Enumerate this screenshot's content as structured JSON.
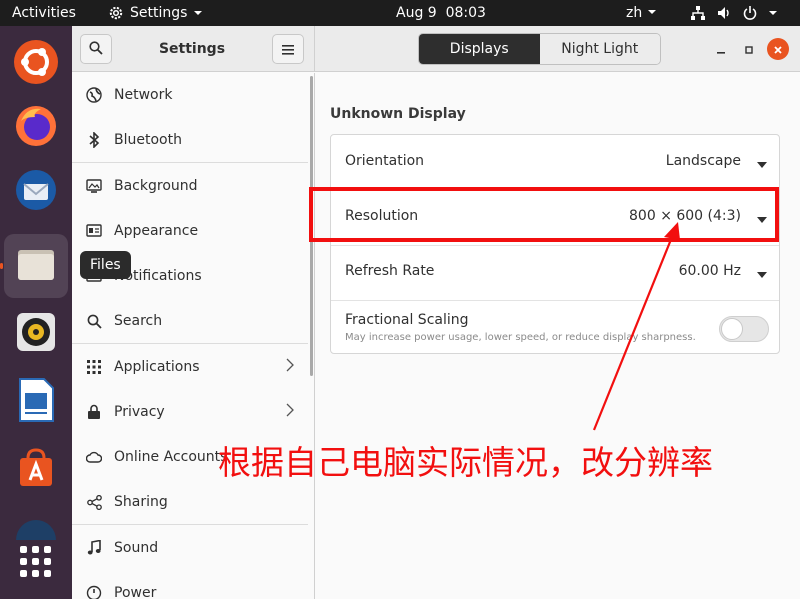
{
  "topbar": {
    "activities": "Activities",
    "app_menu": "Settings",
    "date": "Aug 9",
    "time": "08:03",
    "input_method": "zh"
  },
  "dock": {
    "tooltip": "Files",
    "items": [
      {
        "icon": "ubuntu-software-logo-icon"
      },
      {
        "icon": "firefox-icon"
      },
      {
        "icon": "thunderbird-icon"
      },
      {
        "icon": "files-icon",
        "active": true
      },
      {
        "icon": "rhythmbox-icon"
      },
      {
        "icon": "libreoffice-writer-icon"
      },
      {
        "icon": "ubuntu-software-icon"
      },
      {
        "icon": "help-icon"
      },
      {
        "icon": "show-apps-icon"
      }
    ]
  },
  "header": {
    "title": "Settings",
    "tabs": [
      {
        "label": "Displays",
        "active": true
      },
      {
        "label": "Night Light",
        "active": false
      }
    ]
  },
  "sidebar": {
    "items": [
      {
        "label": "Network",
        "icon": "network-icon"
      },
      {
        "label": "Bluetooth",
        "icon": "bluetooth-icon"
      },
      {
        "label": "Background",
        "icon": "background-icon"
      },
      {
        "label": "Appearance",
        "icon": "appearance-icon"
      },
      {
        "label": "Notifications",
        "icon": "notifications-icon"
      },
      {
        "label": "Search",
        "icon": "search-icon"
      },
      {
        "label": "Applications",
        "icon": "applications-icon",
        "chevron": true
      },
      {
        "label": "Privacy",
        "icon": "privacy-icon",
        "chevron": true
      },
      {
        "label": "Online Accounts",
        "icon": "online-accounts-icon"
      },
      {
        "label": "Sharing",
        "icon": "sharing-icon"
      },
      {
        "label": "Sound",
        "icon": "sound-icon"
      },
      {
        "label": "Power",
        "icon": "power-icon"
      }
    ]
  },
  "display": {
    "name": "Unknown Display",
    "orientation": {
      "label": "Orientation",
      "value": "Landscape"
    },
    "resolution": {
      "label": "Resolution",
      "value": "800 × 600 (4:3)"
    },
    "refresh_rate": {
      "label": "Refresh Rate",
      "value": "60.00 Hz"
    },
    "fractional_scaling": {
      "label": "Fractional Scaling",
      "description": "May increase power usage, lower speed, or reduce display sharpness.",
      "enabled": false
    }
  },
  "annotation": {
    "text": "根据自己电脑实际情况，改分辨率",
    "color": "#f20f0f"
  },
  "colors": {
    "accent": "#e95420",
    "annotation": "#f20f0f",
    "dock_bg": "#3b2a3e",
    "topbar_bg": "#1d1d1d"
  }
}
